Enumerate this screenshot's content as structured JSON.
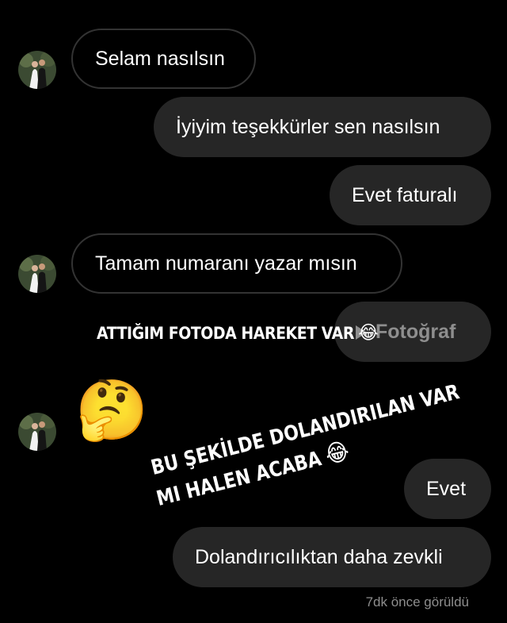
{
  "messages": [
    {
      "id": "m1",
      "direction": "incoming",
      "text": "Selam nasılsın"
    },
    {
      "id": "m2",
      "direction": "outgoing",
      "text": "İyiyim teşekkürler sen nasılsın"
    },
    {
      "id": "m3",
      "direction": "outgoing",
      "text": "Evet faturalı"
    },
    {
      "id": "m4",
      "direction": "incoming",
      "text": "Tamam numaranı yazar mısın"
    },
    {
      "id": "m5",
      "direction": "outgoing",
      "type": "photo",
      "text": "Fotoğraf",
      "icon": "play-icon"
    },
    {
      "id": "m6",
      "direction": "outgoing",
      "text": "Evet"
    },
    {
      "id": "m7",
      "direction": "outgoing",
      "text": "Dolandırıcılıktan daha zevkli"
    }
  ],
  "overlays": {
    "caption_1": "ATTIĞIM FOTODA HAREKET VAR",
    "caption_2_line1": "BU ŞEKİLDE DOLANDIRILAN VAR",
    "caption_2_line2": "MI HALEN ACABA",
    "emoji_laugh": "😂",
    "emoji_thinking": "🤔"
  },
  "seen_status": "7dk önce görüldü",
  "colors": {
    "background": "#000000",
    "outgoing_bubble": "#262626",
    "incoming_border": "#333333",
    "seen_text": "#8e8e8e",
    "photo_label": "#8e8e8e"
  }
}
